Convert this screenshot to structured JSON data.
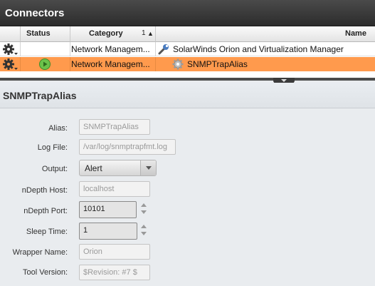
{
  "header": {
    "title": "Connectors"
  },
  "table": {
    "columns": {
      "status": "Status",
      "category": "Category",
      "sort_index": "1",
      "sort_arrow": "▲",
      "name": "Name"
    },
    "rows": [
      {
        "category": "Network Managem...",
        "name": "SolarWinds Orion and Virtualization Manager",
        "selected": false,
        "status_icon": "none",
        "name_icon": "wrench-icon"
      },
      {
        "category": "Network Managem...",
        "name": "SNMPTrapAlias",
        "selected": true,
        "status_icon": "play-running-icon",
        "name_icon": "gear-icon"
      }
    ]
  },
  "detail": {
    "title": "SNMPTrapAlias",
    "fields": {
      "alias": {
        "label": "Alias:",
        "value": "SNMPTrapAlias"
      },
      "log_file": {
        "label": "Log File:",
        "value": "/var/log/snmptrapfmt.log"
      },
      "output": {
        "label": "Output:",
        "value": "Alert"
      },
      "ndepth_host": {
        "label": "nDepth Host:",
        "value": "localhost"
      },
      "ndepth_port": {
        "label": "nDepth Port:",
        "value": "10101"
      },
      "sleep_time": {
        "label": "Sleep Time:",
        "value": "1"
      },
      "wrapper_name": {
        "label": "Wrapper Name:",
        "value": "Orion"
      },
      "tool_version": {
        "label": "Tool Version:",
        "value": "$Revision: #7 $"
      }
    }
  },
  "colors": {
    "selected_row": "#ff9a4d",
    "header_bg": "#3a3a3a",
    "status_green": "#6cc24a"
  }
}
